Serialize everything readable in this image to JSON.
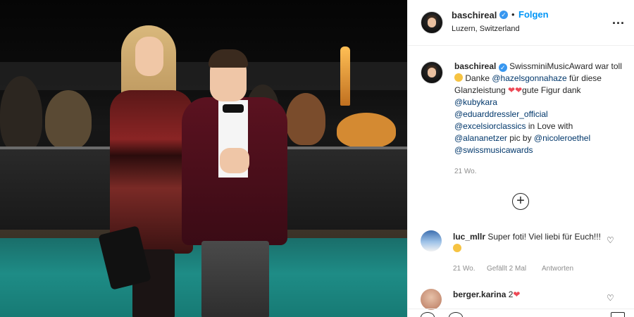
{
  "post": {
    "username": "baschireal",
    "follow_label": "Folgen",
    "dot": "•",
    "location": "Luzern, Switzerland",
    "more_label": "...",
    "caption": {
      "username": "baschireal",
      "text_1": "SwissminiMusicAward war toll ",
      "text_2": " Danke ",
      "m1": "@hazelsgonnahaze",
      "text_3": " für diese Glanzleistung ",
      "text_4": "gute Figur dank ",
      "m2": "@kubykara",
      "m3": "@eduarddressler_official",
      "m4": "@excelsiorclassics",
      "text_5": " in Love with ",
      "m5": "@alananetzer",
      "text_6": " pic by ",
      "m6": "@nicoleroethel",
      "m7": "@swissmusicawards",
      "heart": "❤",
      "time": "21 Wo."
    },
    "load_more": "+"
  },
  "comments": [
    {
      "username": "luc_mllr",
      "text": "Super foti! Viel liebi für Euch!!!",
      "time": "21 Wo.",
      "likes": "Gefällt 2 Mal",
      "reply": "Antworten",
      "heart": "♡"
    },
    {
      "username": "berger.karina",
      "text": "2",
      "heart_icon": "❤",
      "like": "♡"
    }
  ],
  "colors": {
    "accent": "#0095f6",
    "verified": "#3897f0",
    "mention": "#00376b",
    "heart": "#ed4956",
    "meta": "#8e8e8e"
  },
  "icons": [
    "verified-badge-icon",
    "more-options-icon",
    "heart-icon",
    "plus-circle-icon",
    "like-icon",
    "comment-icon",
    "bookmark-icon"
  ]
}
